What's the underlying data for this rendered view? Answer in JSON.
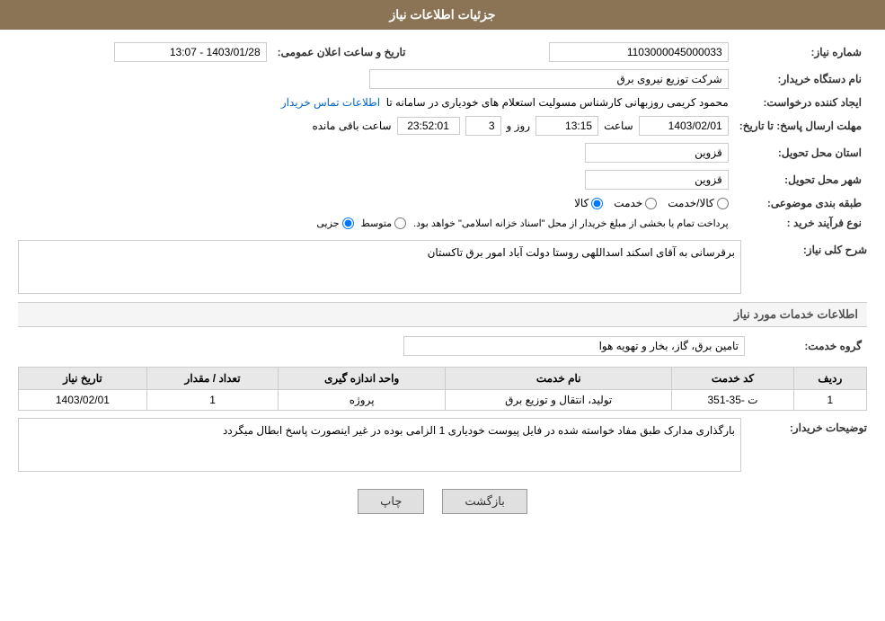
{
  "page": {
    "title": "جزئیات اطلاعات نیاز",
    "sections": {
      "header": "جزئیات اطلاعات نیاز",
      "need_number_label": "شماره نیاز:",
      "need_number_value": "1103000045000033",
      "buyer_name_label": "نام دستگاه خریدار:",
      "buyer_name_value": "شرکت توزیع نیروی برق",
      "creator_label": "ایجاد کننده درخواست:",
      "creator_value": "محمود کریمی روزبهانی کارشناس  مسولیت استعلام های خودیاری در سامانه تا",
      "creator_link": "اطلاعات تماس خریدار",
      "send_date_label": "مهلت ارسال پاسخ: تا تاریخ:",
      "send_date_value": "1403/02/01",
      "send_time_label": "ساعت",
      "send_time_value": "13:15",
      "send_days_label": "روز و",
      "send_days_value": "3",
      "send_remaining_label": "ساعت باقی مانده",
      "send_remaining_value": "23:52:01",
      "announce_date_label": "تاریخ و ساعت اعلان عمومی:",
      "announce_date_value": "1403/01/28 - 13:07",
      "province_label": "استان محل تحویل:",
      "province_value": "قزوین",
      "city_label": "شهر محل تحویل:",
      "city_value": "قزوین",
      "category_label": "طبقه بندی موضوعی:",
      "category_kala": "کالا",
      "category_khedmat": "خدمت",
      "category_kala_khedmat": "کالا/خدمت",
      "purchase_type_label": "نوع فرآیند خرید :",
      "purchase_type_jozei": "جزیی",
      "purchase_type_motavaset": "متوسط",
      "purchase_type_note": "پرداخت تمام یا بخشی از مبلغ خریدار از محل \"اسناد خزانه اسلامی\" خواهد بود.",
      "need_description_label": "شرح کلی نیاز:",
      "need_description_value": "برقرسانی به آقای اسکند اسداللهی روستا دولت آباد امور برق تاکستان",
      "services_label": "اطلاعات خدمات مورد نیاز",
      "service_group_label": "گروه خدمت:",
      "service_group_value": "تامین برق، گاز، بخار و تهویه هوا",
      "table_headers": {
        "row_number": "ردیف",
        "service_code": "کد خدمت",
        "service_name": "نام خدمت",
        "unit": "واحد اندازه گیری",
        "quantity": "تعداد / مقدار",
        "date": "تاریخ نیاز"
      },
      "table_rows": [
        {
          "row": "1",
          "code": "ت -35-351",
          "name": "تولید، انتقال و توزیع برق",
          "unit": "پروژه",
          "quantity": "1",
          "date": "1403/02/01"
        }
      ],
      "buyer_notes_label": "توضیحات خریدار:",
      "buyer_notes_value": "بارگذاری مدارک طبق مفاد خواسته شده در فایل پیوست خودیاری 1 الزامی بوده در غیر اینصورت پاسخ ابطال میگردد",
      "btn_print": "چاپ",
      "btn_back": "بازگشت"
    }
  }
}
